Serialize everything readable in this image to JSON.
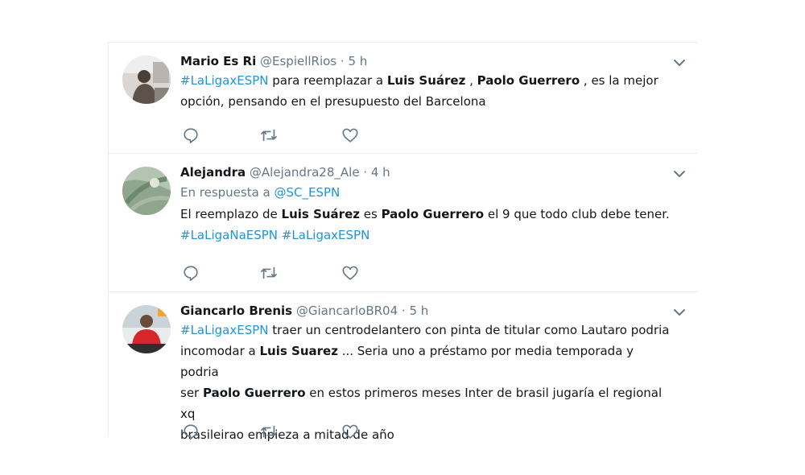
{
  "tweets": [
    {
      "name": "Mario Es Ri",
      "handle": "@EspiellRios",
      "sep": " · ",
      "time": "5 h",
      "avatar_icon": "person-at-desk-photo",
      "text": {
        "l1_hashtag": "#LaLigaxESPN",
        "l1_a": " para reemplazar a ",
        "l1_bold1": "Luis Suárez",
        "l1_b": " , ",
        "l1_bold2": "Paolo Guerrero",
        "l1_c": " , es la mejor",
        "l2": "opción, pensando en el presupuesto del Barcelona"
      }
    },
    {
      "name": "Alejandra",
      "handle": "@Alejandra28_Ale",
      "sep": " · ",
      "time": "4 h",
      "avatar_icon": "green-abstract-photo",
      "reply_prefix": "En respuesta a ",
      "reply_handle": "@SC_ESPN",
      "text": {
        "l1_a": "El reemplazo de ",
        "l1_bold1": "Luis Suárez",
        "l1_b": " es ",
        "l1_bold2": "Paolo Guerrero",
        "l1_c": " el 9 que todo club debe tener.",
        "l2_hashtag1": "#LaLigaNaESPN",
        "l2_space": " ",
        "l2_hashtag2": "#LaLigaxESPN"
      }
    },
    {
      "name": "Giancarlo Brenis",
      "handle": "@GiancarloBR04",
      "sep": " · ",
      "time": "5 h",
      "avatar_icon": "person-in-red-shirt-photo",
      "text": {
        "l1_hashtag": "#LaLigaxESPN",
        "l1_a": " traer un centrodelantero con pinta de titular como Lautaro podria",
        "l2_a": "incomodar a ",
        "l2_bold": "Luis Suarez",
        "l2_b": " ... Seria uno a préstamo por media temporada y podria",
        "l3_a": "ser ",
        "l3_bold": "Paolo Guerrero",
        "l3_b": " en estos primeros meses Inter de brasil jugaría el regional xq",
        "l4": "brasileirao empieza a mitad de año"
      }
    }
  ],
  "colors": {
    "link": "#1b95e0",
    "secondary": "#657786",
    "border": "#e6ecf0"
  }
}
